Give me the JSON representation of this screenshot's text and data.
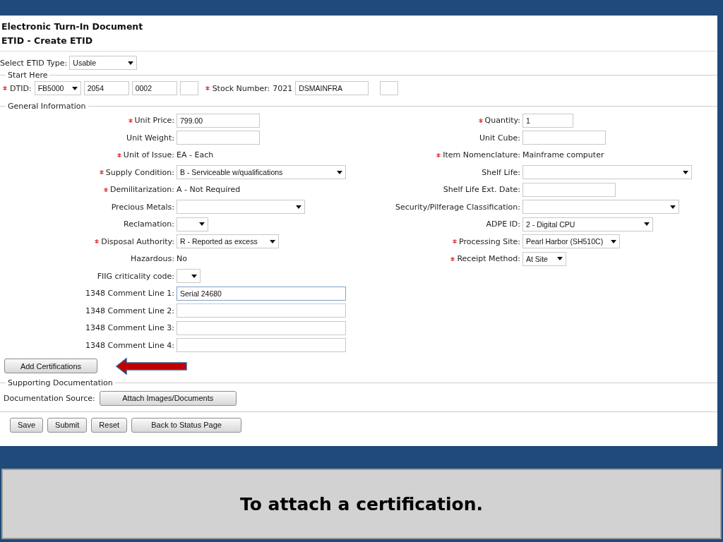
{
  "header": {
    "title": "Electronic Turn-In Document",
    "subtitle": "ETID - Create ETID"
  },
  "etid_type": {
    "label": "Select ETID Type:",
    "value": "Usable"
  },
  "start_here": {
    "legend": "Start Here",
    "dtid": {
      "label": "DTID:",
      "required": true,
      "select": "FB5000",
      "parts": [
        "2054",
        "0002"
      ]
    },
    "stock": {
      "label": "Stock Number:",
      "required": true,
      "prefix": "7021",
      "value": "DSMAINFRA"
    }
  },
  "general": {
    "legend": "General Information",
    "rows": [
      {
        "left": {
          "label": "Unit Price:",
          "required": true,
          "kind": "input",
          "value": "799.00"
        },
        "right": {
          "label": "Quantity:",
          "required": true,
          "kind": "input",
          "value": "1"
        }
      },
      {
        "left": {
          "label": "Unit Weight:",
          "required": false,
          "kind": "input"
        },
        "right": {
          "label": "Unit Cube:",
          "required": false,
          "kind": "input"
        }
      },
      {
        "left": {
          "label": "Unit of Issue:",
          "required": true,
          "kind": "text",
          "value": "EA - Each"
        },
        "right": {
          "label": "Item Nomenclature:",
          "required": true,
          "kind": "text",
          "value": "Mainframe computer"
        }
      },
      {
        "left": {
          "label": "Supply Condition:",
          "required": true,
          "kind": "select",
          "value": "B - Serviceable w/qualifications"
        },
        "right": {
          "label": "Shelf Life:",
          "required": false,
          "kind": "select"
        }
      },
      {
        "left": {
          "label": "Demilitarization:",
          "required": true,
          "kind": "text",
          "value": "A - Not Required"
        },
        "right": {
          "label": "Shelf Life Ext. Date:",
          "required": false,
          "kind": "input"
        }
      },
      {
        "left": {
          "label": "Precious Metals:",
          "required": false,
          "kind": "select"
        },
        "right": {
          "label": "Security/Pilferage Classification:",
          "required": false,
          "kind": "select"
        }
      },
      {
        "left": {
          "label": "Reclamation:",
          "required": false,
          "kind": "select"
        },
        "right": {
          "label": "ADPE ID:",
          "required": false,
          "kind": "select",
          "value": "2 - Digital CPU"
        }
      },
      {
        "left": {
          "label": "Disposal Authority:",
          "required": true,
          "kind": "select",
          "value": "R - Reported as excess"
        },
        "right": {
          "label": "Processing Site:",
          "required": true,
          "kind": "select",
          "value": "Pearl Harbor (SH510C)"
        }
      },
      {
        "left": {
          "label": "Hazardous:",
          "required": false,
          "kind": "text",
          "value": "No"
        },
        "right": {
          "label": "Receipt Method:",
          "required": true,
          "kind": "select",
          "value": "At Site"
        }
      },
      {
        "left": {
          "label": "FIIG criticality code:",
          "required": false,
          "kind": "select"
        }
      },
      {
        "left": {
          "label": "1348 Comment Line 1:",
          "required": false,
          "kind": "comment",
          "value": "Serial 24680",
          "focused": true
        }
      },
      {
        "left": {
          "label": "1348 Comment Line 2:",
          "required": false,
          "kind": "comment",
          "focused": false
        }
      },
      {
        "left": {
          "label": "1348 Comment Line 3:",
          "required": false,
          "kind": "comment",
          "focused": false
        }
      },
      {
        "left": {
          "label": "1348 Comment Line 4:",
          "required": false,
          "kind": "comment",
          "focused": false
        }
      }
    ],
    "button": "Add Certifications"
  },
  "supporting": {
    "legend": "Supporting Documentation",
    "label": "Documentation Source:",
    "button": "Attach Images/Documents"
  },
  "actions": [
    "Save",
    "Submit",
    "Reset",
    "Back to Status Page"
  ],
  "caption": "To attach a certification."
}
